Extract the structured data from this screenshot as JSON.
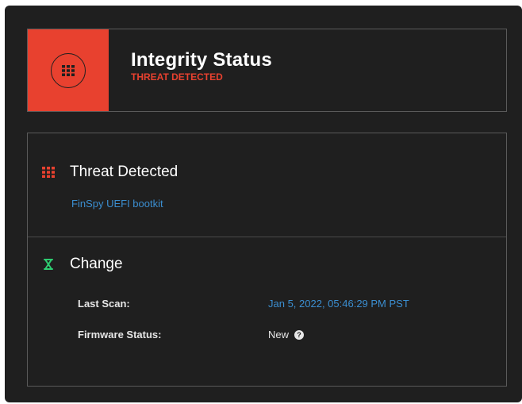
{
  "header": {
    "title": "Integrity Status",
    "subtitle": "THREAT DETECTED",
    "badge_icon": "grid-icon",
    "badge_color": "#e8412f"
  },
  "threat_section": {
    "icon": "grid-icon",
    "title": "Threat Detected",
    "threat_name": "FinSpy UEFI bootkit",
    "accent_color": "#e8412f"
  },
  "change_section": {
    "icon": "hourglass-icon",
    "title": "Change",
    "accent_color": "#2ecc71",
    "rows": [
      {
        "label": "Last Scan:",
        "value": "Jan 5, 2022, 05:46:29 PM PST"
      },
      {
        "label": "Firmware Status:",
        "value": "New",
        "value_icon": "help-icon"
      }
    ]
  },
  "colors": {
    "background": "#1f1f1f",
    "link": "#3b8ed0",
    "danger": "#e8412f",
    "success": "#2ecc71"
  }
}
